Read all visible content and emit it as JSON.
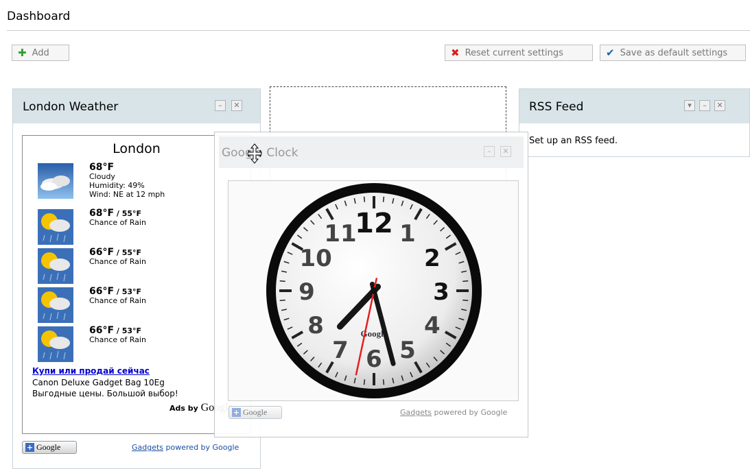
{
  "header": {
    "title": "Dashboard"
  },
  "toolbar": {
    "add_label": "Add",
    "reset_label": "Reset current settings",
    "save_default_label": "Save as default settings"
  },
  "weather_widget": {
    "title": "London Weather",
    "city": "London",
    "current": {
      "temp": "68°F",
      "condition": "Cloudy",
      "humidity": "Humidity: 49%",
      "wind": "Wind: NE at 12 mph"
    },
    "forecast": [
      {
        "high": "68°F",
        "low": " / 55°F",
        "condition": "Chance of Rain"
      },
      {
        "high": "66°F",
        "low": " / 55°F",
        "condition": "Chance of Rain"
      },
      {
        "high": "66°F",
        "low": " / 53°F",
        "condition": "Chance of Rain"
      },
      {
        "high": "66°F",
        "low": " / 53°F",
        "condition": "Chance of Rain"
      }
    ],
    "ad": {
      "title": "Купи или продай сейчас",
      "line1": "Canon Deluxe Gadget Bag 10Eg",
      "line2": "Выгодные цены. Большой выбор!",
      "ads_by": "Ads by ",
      "google": "Google"
    },
    "add_google_label": "Google",
    "gadgets_link": "Gadgets",
    "powered_by": " powered by Google"
  },
  "clock_widget": {
    "title": "Google Clock",
    "brand": "Google",
    "hour_numbers": [
      "12",
      "1",
      "2",
      "3",
      "4",
      "5",
      "6",
      "7",
      "8",
      "9",
      "10",
      "11"
    ],
    "time": {
      "hour": 7,
      "minute": 27,
      "second": 32
    },
    "add_google_label": "Google",
    "gadgets_link": "Gadgets",
    "powered_by": " powered by Google"
  },
  "rss_widget": {
    "title": "RSS Feed",
    "body": "Set up an RSS feed."
  },
  "icons": {
    "add": "plus-icon",
    "reset": "x-icon",
    "save": "checkmark-icon",
    "minimize": "minimize-icon",
    "close": "close-icon",
    "menu": "chevron-down-icon",
    "move": "move-cursor-icon"
  },
  "colors": {
    "panel_header": "#d8e4e8",
    "add_icon": "#2f9e2f",
    "reset_icon": "#d42020",
    "save_icon": "#2260a8",
    "link": "#0000cc",
    "second_hand": "#e51e1e"
  }
}
